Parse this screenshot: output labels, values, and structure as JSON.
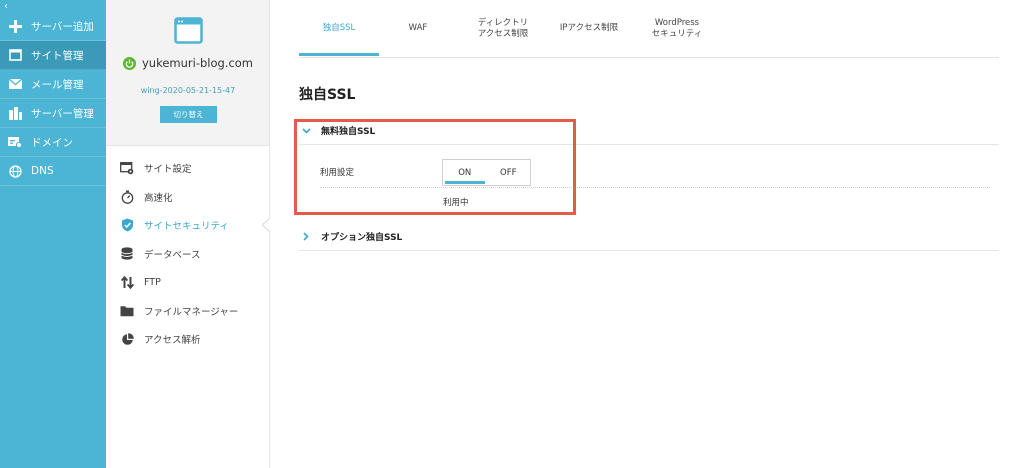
{
  "nav": {
    "collapse_glyph": "‹",
    "items": [
      {
        "label": "サーバー追加",
        "icon": "plus-icon"
      },
      {
        "label": "サイト管理",
        "icon": "window-icon",
        "active": true
      },
      {
        "label": "メール管理",
        "icon": "mail-icon"
      },
      {
        "label": "サーバー管理",
        "icon": "server-icon"
      },
      {
        "label": "ドメイン",
        "icon": "domain-icon"
      },
      {
        "label": "DNS",
        "icon": "globe-icon"
      }
    ]
  },
  "site": {
    "domain": "yukemuri-blog.com",
    "server_id": "wing-2020-05-21-15-47",
    "switch_label": "切り替え"
  },
  "menu": {
    "items": [
      {
        "label": "サイト設定",
        "icon": "site-settings-icon"
      },
      {
        "label": "高速化",
        "icon": "stopwatch-icon"
      },
      {
        "label": "サイトセキュリティ",
        "icon": "shield-check-icon",
        "active": true
      },
      {
        "label": "データベース",
        "icon": "database-icon"
      },
      {
        "label": "FTP",
        "icon": "transfer-arrows-icon"
      },
      {
        "label": "ファイルマネージャー",
        "icon": "folder-icon"
      },
      {
        "label": "アクセス解析",
        "icon": "pie-chart-icon"
      }
    ]
  },
  "tabs": [
    {
      "line1": "独自SSL",
      "line2": "",
      "active": true
    },
    {
      "line1": "WAF",
      "line2": ""
    },
    {
      "line1": "ディレクトリ",
      "line2": "アクセス制限"
    },
    {
      "line1": "IPアクセス制限",
      "line2": ""
    },
    {
      "line1": "WordPress",
      "line2": "セキュリティ"
    }
  ],
  "page": {
    "title": "独自SSL",
    "section_free": "無料独自SSL",
    "setting_label": "利用設定",
    "toggle_on": "ON",
    "toggle_off": "OFF",
    "status": "利用中",
    "section_option": "オプション独自SSL"
  },
  "colors": {
    "accent": "#4cb4d4",
    "highlight": "#e55b4a"
  }
}
